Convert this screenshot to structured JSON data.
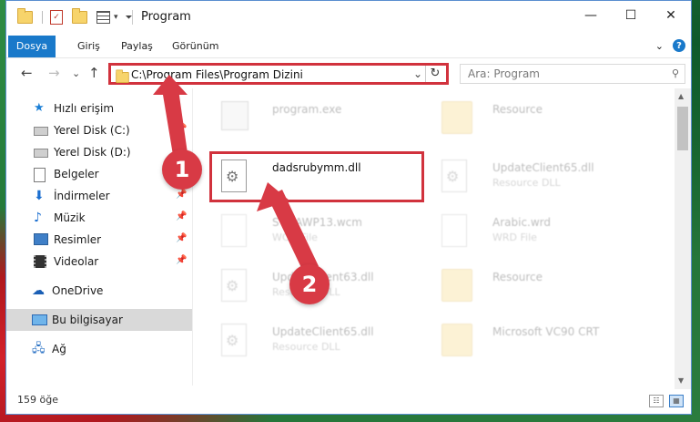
{
  "window": {
    "title": "Program",
    "controls": {
      "minimize": "—",
      "maximize": "☐",
      "close": "✕"
    }
  },
  "quick_access_toolbar": {
    "icons": [
      "folder-icon",
      "properties-check-icon",
      "new-folder-icon",
      "view-list-icon",
      "customize-dropdown-icon"
    ]
  },
  "ribbon": {
    "tabs": [
      "Dosya",
      "Giriş",
      "Paylaş",
      "Görünüm"
    ],
    "expand_label": "⌄",
    "help_label": "?"
  },
  "address_bar": {
    "back": "←",
    "forward": "→",
    "recent": "⌄",
    "up": "↑",
    "path": "C:\\Program Files\\Program Dizini",
    "dropdown": "⌄",
    "refresh": "↻"
  },
  "search": {
    "placeholder": "Ara: Program",
    "icon": "search-icon"
  },
  "navigation_pane": {
    "items": [
      {
        "label": "Hızlı erişim",
        "icon": "star-icon",
        "pinned": false
      },
      {
        "label": "Yerel Disk (C:)",
        "icon": "disk-icon",
        "pinned": true
      },
      {
        "label": "Yerel Disk (D:)",
        "icon": "disk-icon",
        "pinned": true
      },
      {
        "label": "Belgeler",
        "icon": "document-icon",
        "pinned": true
      },
      {
        "label": "İndirmeler",
        "icon": "download-icon",
        "pinned": true
      },
      {
        "label": "Müzik",
        "icon": "music-icon",
        "pinned": true
      },
      {
        "label": "Resimler",
        "icon": "pictures-icon",
        "pinned": true
      },
      {
        "label": "Videolar",
        "icon": "videos-icon",
        "pinned": true
      },
      {
        "label": "OneDrive",
        "icon": "cloud-icon",
        "pinned": false
      },
      {
        "label": "Bu bilgisayar",
        "icon": "computer-icon",
        "pinned": false,
        "selected": true
      },
      {
        "label": "Ağ",
        "icon": "network-icon",
        "pinned": false
      }
    ],
    "pin_glyph": "📌"
  },
  "files": [
    {
      "name": "program.exe",
      "type": "",
      "icon": "exe-icon",
      "faded": true
    },
    {
      "name": "Resource",
      "type": "",
      "icon": "folder-icon",
      "faded": true
    },
    {
      "name": "dadsrubymm.dll",
      "type": "",
      "icon": "dll-icon",
      "faded": false
    },
    {
      "name": "UpdateClient65.dll",
      "type": "Resource DLL",
      "icon": "dll-icon",
      "faded": true
    },
    {
      "name": "SVGAWP13.wcm",
      "type": "WCM File",
      "icon": "file-icon",
      "faded": true
    },
    {
      "name": "Arabic.wrd",
      "type": "WRD File",
      "icon": "file-icon",
      "faded": true
    },
    {
      "name": "UpdateClient63.dll",
      "type": "Resource DLL",
      "icon": "dll-icon",
      "faded": true
    },
    {
      "name": "Resource",
      "type": "",
      "icon": "folder-icon",
      "faded": true
    },
    {
      "name": "UpdateClient65.dll",
      "type": "Resource DLL",
      "icon": "dll-icon",
      "faded": true
    },
    {
      "name": "Microsoft VC90 CRT",
      "type": "",
      "icon": "folder-icon",
      "faded": true
    }
  ],
  "status_bar": {
    "item_count": "159 öğe",
    "view_details": "☷",
    "view_large": "▦"
  },
  "annotations": {
    "badge_1": "1",
    "badge_2": "2",
    "color": "#d83a45"
  }
}
